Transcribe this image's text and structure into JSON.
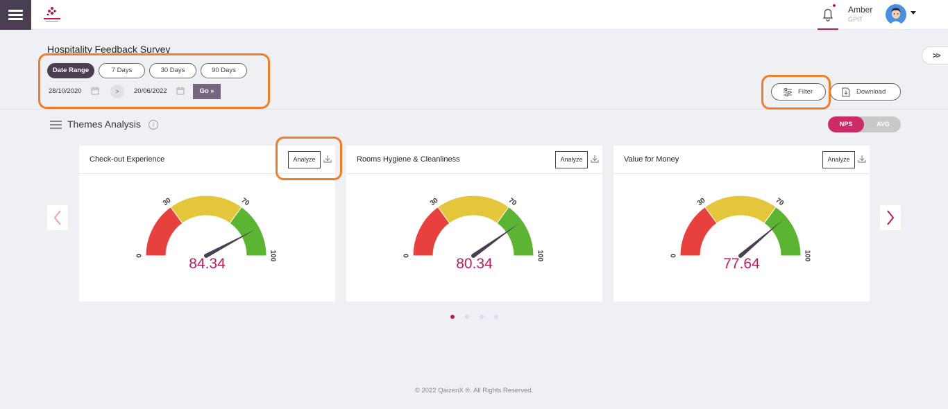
{
  "header": {
    "user_name": "Amber",
    "user_org": "GPIT"
  },
  "page": {
    "title": "Hospitality Feedback Survey"
  },
  "date_filters": {
    "range_buttons": [
      "Date Range",
      "7 Days",
      "30 Days",
      "90 Days"
    ],
    "active_range": "Date Range",
    "from_date": "28/10/2020",
    "to_date": "20/06/2022",
    "go_label": "Go »"
  },
  "toolbar": {
    "filter_label": "Filter",
    "download_label": "Download"
  },
  "themes": {
    "title": "Themes Analysis",
    "info_glyph": "i",
    "toggle_options": [
      "NPS",
      "AVG"
    ],
    "active_toggle": "NPS"
  },
  "gauge_scale": {
    "min": 0,
    "max": 100,
    "ticks": [
      "0",
      "30",
      "70",
      "100"
    ],
    "bands": [
      {
        "from": 0,
        "to": 30,
        "color": "#e8403c"
      },
      {
        "from": 30,
        "to": 70,
        "color": "#e4c63a"
      },
      {
        "from": 70,
        "to": 100,
        "color": "#5cb532"
      }
    ]
  },
  "cards": [
    {
      "title": "Check-out Experience",
      "analyze_label": "Analyze",
      "value": 84.34,
      "value_text": "84.34"
    },
    {
      "title": "Rooms Hygiene & Cleanliness",
      "analyze_label": "Analyze",
      "value": 80.34,
      "value_text": "80.34"
    },
    {
      "title": "Value for Money",
      "analyze_label": "Analyze",
      "value": 77.64,
      "value_text": "77.64"
    }
  ],
  "carousel": {
    "page_count": 4,
    "active_page": 1
  },
  "colors": {
    "brand_dark": "#4a3f52",
    "accent": "#c2185b",
    "nps_active": "#cc2b66",
    "highlight": "#f07c2a"
  },
  "footer": {
    "text": "© 2022 QaizenX ®. All Rights Reserved."
  }
}
